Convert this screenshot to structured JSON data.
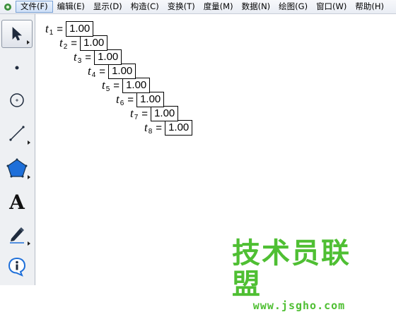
{
  "menu": {
    "items": [
      "文件(F)",
      "编辑(E)",
      "显示(D)",
      "构造(C)",
      "变换(T)",
      "度量(M)",
      "数据(N)",
      "绘图(G)",
      "窗口(W)",
      "帮助(H)"
    ]
  },
  "toolbox": {
    "tools": [
      "selection-arrow",
      "point",
      "compass",
      "straightedge",
      "polygon",
      "text",
      "marker",
      "information"
    ],
    "text_tool_glyph": "A"
  },
  "parameters": [
    {
      "var": "t",
      "sub": "1",
      "eq": "=",
      "value": "1.00"
    },
    {
      "var": "t",
      "sub": "2",
      "eq": "=",
      "value": "1.00"
    },
    {
      "var": "t",
      "sub": "3",
      "eq": "=",
      "value": "1.00"
    },
    {
      "var": "t",
      "sub": "4",
      "eq": "=",
      "value": "1.00"
    },
    {
      "var": "t",
      "sub": "5",
      "eq": "=",
      "value": "1.00"
    },
    {
      "var": "t",
      "sub": "6",
      "eq": "=",
      "value": "1.00"
    },
    {
      "var": "t",
      "sub": "7",
      "eq": "=",
      "value": "1.00"
    },
    {
      "var": "t",
      "sub": "8",
      "eq": "=",
      "value": "1.00"
    }
  ],
  "watermark": {
    "title": "技术员联盟",
    "url": "www.jsgho.com",
    "color": "#4fbf33"
  }
}
